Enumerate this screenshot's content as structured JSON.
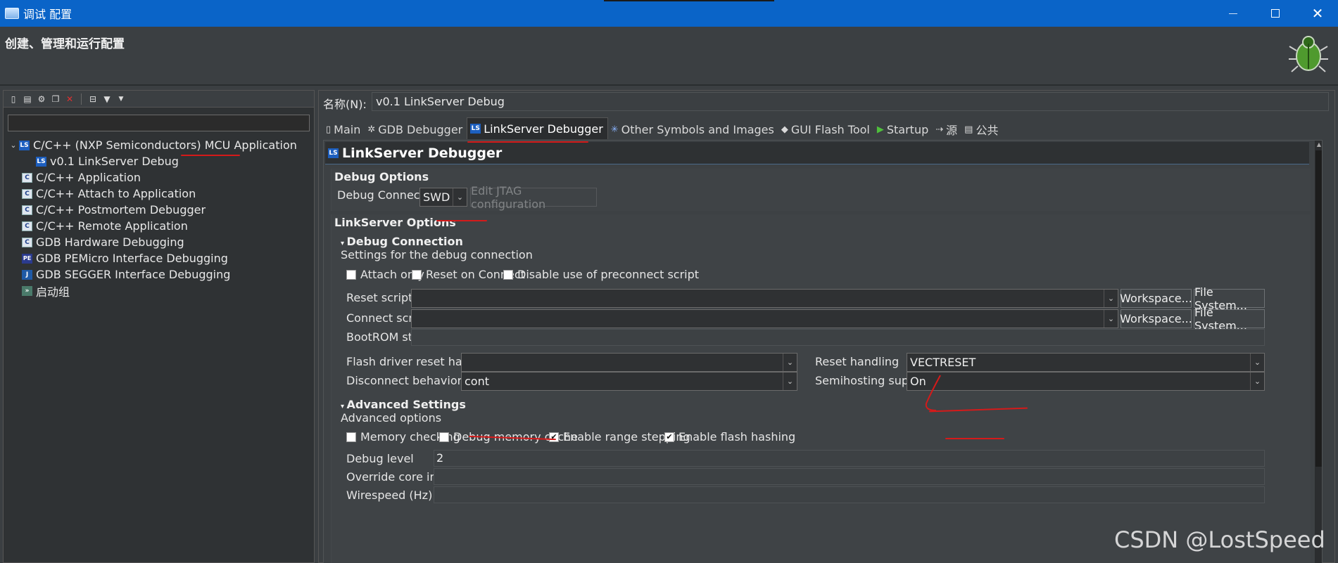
{
  "window": {
    "title": "调试 配置"
  },
  "header": {
    "title": "创建、管理和运行配置"
  },
  "left": {
    "toolbar": [
      "new-config-icon",
      "duplicate-icon",
      "export-icon",
      "copy-icon",
      "delete-icon",
      "collapse-all-icon",
      "filter-icon",
      "view-menu-icon"
    ],
    "tree": [
      {
        "label": "C/C++ (NXP Semiconductors) MCU Application",
        "icon": "LS",
        "expanded": true,
        "level": 0
      },
      {
        "label": "v0.1 LinkServer Debug",
        "icon": "LS",
        "level": 1,
        "selected": true
      },
      {
        "label": "C/C++ Application",
        "icon": "C",
        "level": 0
      },
      {
        "label": "C/C++ Attach to Application",
        "icon": "C",
        "level": 0
      },
      {
        "label": "C/C++ Postmortem Debugger",
        "icon": "C",
        "level": 0
      },
      {
        "label": "C/C++ Remote Application",
        "icon": "C",
        "level": 0
      },
      {
        "label": "GDB Hardware Debugging",
        "icon": "C",
        "level": 0
      },
      {
        "label": "GDB PEMicro Interface Debugging",
        "icon": "PE",
        "level": 0
      },
      {
        "label": "GDB SEGGER Interface Debugging",
        "icon": "J",
        "level": 0
      },
      {
        "label": "启动组",
        "icon": "group",
        "level": 0
      }
    ]
  },
  "right": {
    "name_label": "名称(N):",
    "name_value": "v0.1 LinkServer Debug",
    "tabs": [
      {
        "label": "Main",
        "icon": "▯"
      },
      {
        "label": "GDB Debugger",
        "icon": "✲"
      },
      {
        "label": "LinkServer Debugger",
        "icon": "LS",
        "active": true
      },
      {
        "label": "Other Symbols and Images",
        "icon": "✳"
      },
      {
        "label": "GUI Flash Tool",
        "icon": "◆"
      },
      {
        "label": "Startup",
        "icon": "▶"
      },
      {
        "label": "源",
        "icon": "⇢"
      },
      {
        "label": "公共",
        "icon": "▤"
      }
    ],
    "section_title": "LinkServer Debugger",
    "debug_options": {
      "title": "Debug Options",
      "connection_label": "Debug Connection",
      "connection_value": "SWD",
      "jtag_button": "Edit JTAG configuration"
    },
    "linkserver_options": {
      "title": "LinkServer Options",
      "debug_connection": {
        "title": "Debug Connection",
        "desc": "Settings for the debug connection",
        "checkboxes": [
          {
            "label": "Attach only",
            "checked": false
          },
          {
            "label": "Reset on Connect",
            "checked": false
          },
          {
            "label": "Disable use of preconnect script",
            "checked": false
          }
        ],
        "reset_script_label": "Reset script",
        "connect_script_label": "Connect script",
        "workspace_button": "Workspace...",
        "filesystem_button": "File System...",
        "bootrom_label": "BootROM stall",
        "flash_reset_label": "Flash driver reset handling",
        "flash_reset_value": "",
        "reset_handling_label": "Reset handling",
        "reset_handling_value": "VECTRESET",
        "disconnect_label": "Disconnect behavior",
        "disconnect_value": "cont",
        "semihosting_label": "Semihosting support",
        "semihosting_value": "On"
      },
      "advanced": {
        "title": "Advanced Settings",
        "desc": "Advanced options",
        "checkboxes": [
          {
            "label": "Memory checking",
            "checked": false
          },
          {
            "label": "Debug memory cache",
            "checked": false
          },
          {
            "label": "Enable range stepping",
            "checked": true
          },
          {
            "label": "Enable flash hashing",
            "checked": true
          }
        ],
        "debug_level_label": "Debug level",
        "debug_level_value": "2",
        "override_core_label": "Override core index",
        "wirespeed_label": "Wirespeed (Hz)"
      }
    }
  },
  "watermark": "CSDN @LostSpeed",
  "colors": {
    "titlebar": "#0a64c8",
    "annotation_red": "#d51a1a"
  }
}
